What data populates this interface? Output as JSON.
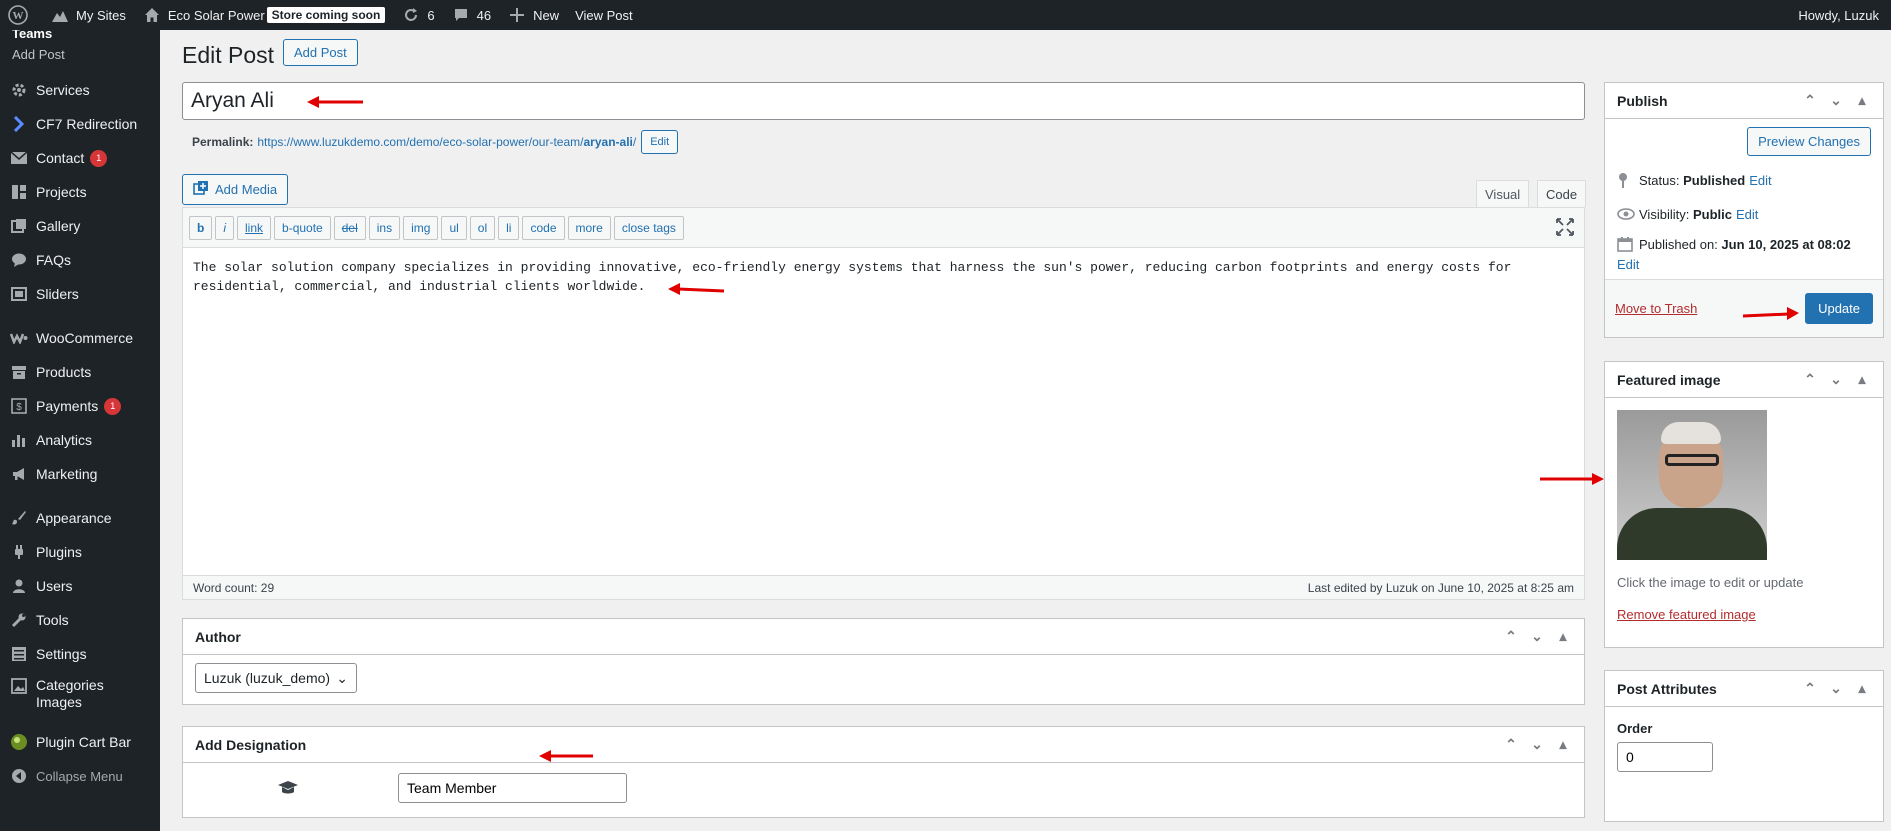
{
  "admin_bar": {
    "my_sites": "My Sites",
    "site_name": "Eco Solar Power",
    "store_badge": "Store coming soon",
    "updates_count": "6",
    "comments_count": "46",
    "new_label": "New",
    "view_post": "View Post",
    "howdy": "Howdy, Luzuk"
  },
  "sidebar": {
    "partial_header": "Teams",
    "sub_add_post": "Add Post",
    "items": [
      {
        "label": "Services",
        "icon": "gear-icon"
      },
      {
        "label": "CF7 Redirection",
        "icon": "redirect-icon"
      },
      {
        "label": "Contact",
        "icon": "mail-icon",
        "count": "1"
      },
      {
        "label": "Projects",
        "icon": "grid-icon"
      },
      {
        "label": "Gallery",
        "icon": "gallery-icon"
      },
      {
        "label": "FAQs",
        "icon": "speech-bubble-icon"
      },
      {
        "label": "Sliders",
        "icon": "slides-icon"
      },
      {
        "label": "WooCommerce",
        "icon": "woo-icon"
      },
      {
        "label": "Products",
        "icon": "archive-icon"
      },
      {
        "label": "Payments",
        "icon": "dollar-icon",
        "count": "1"
      },
      {
        "label": "Analytics",
        "icon": "bar-chart-icon"
      },
      {
        "label": "Marketing",
        "icon": "megaphone-icon"
      },
      {
        "label": "Appearance",
        "icon": "paintbrush-icon"
      },
      {
        "label": "Plugins",
        "icon": "plug-icon"
      },
      {
        "label": "Users",
        "icon": "user-icon"
      },
      {
        "label": "Tools",
        "icon": "wrench-icon"
      },
      {
        "label": "Settings",
        "icon": "sliders-icon"
      },
      {
        "label": "Categories Images",
        "icon": "image-icon"
      },
      {
        "label": "Plugin Cart Bar",
        "icon": "cart-bar-icon"
      },
      {
        "label": "Collapse Menu",
        "icon": "collapse-icon"
      }
    ]
  },
  "page": {
    "title": "Edit Post",
    "add_post_button": "Add Post",
    "post_title": "Aryan Ali",
    "permalink_label": "Permalink:",
    "permalink_base": "https://www.luzukdemo.com/demo/eco-solar-power/our-team/",
    "permalink_slug": "aryan-ali",
    "permalink_trailing": "/",
    "permalink_edit": "Edit"
  },
  "editor": {
    "add_media": "Add Media",
    "tab_visual": "Visual",
    "tab_code": "Code",
    "buttons": [
      "b",
      "i",
      "link",
      "b-quote",
      "del",
      "ins",
      "img",
      "ul",
      "ol",
      "li",
      "code",
      "more",
      "close tags"
    ],
    "content": "The solar solution company specializes in providing innovative, eco-friendly energy systems that harness the sun's power, reducing carbon footprints and energy costs for residential, commercial, and industrial clients worldwide.",
    "word_count": "Word count: 29",
    "last_edited": "Last edited by Luzuk on June 10, 2025 at 8:25 am"
  },
  "author_box": {
    "title": "Author",
    "selected": "Luzuk (luzuk_demo)"
  },
  "designation_box": {
    "title": "Add Designation",
    "value": "Team Member"
  },
  "publish_box": {
    "title": "Publish",
    "preview": "Preview Changes",
    "status_label": "Status:",
    "status_value": "Published",
    "visibility_label": "Visibility:",
    "visibility_value": "Public",
    "published_label": "Published on:",
    "published_value": "Jun 10, 2025 at 08:02",
    "edit": "Edit",
    "trash": "Move to Trash",
    "update": "Update"
  },
  "featured_box": {
    "title": "Featured image",
    "hint": "Click the image to edit or update",
    "remove": "Remove featured image"
  },
  "attributes_box": {
    "title": "Post Attributes",
    "order_label": "Order",
    "order_value": "0"
  },
  "colors": {
    "admin_dark": "#1d2327",
    "primary_blue": "#2271b1",
    "danger_red": "#d63638",
    "annotation_arrow": "#e00000"
  }
}
